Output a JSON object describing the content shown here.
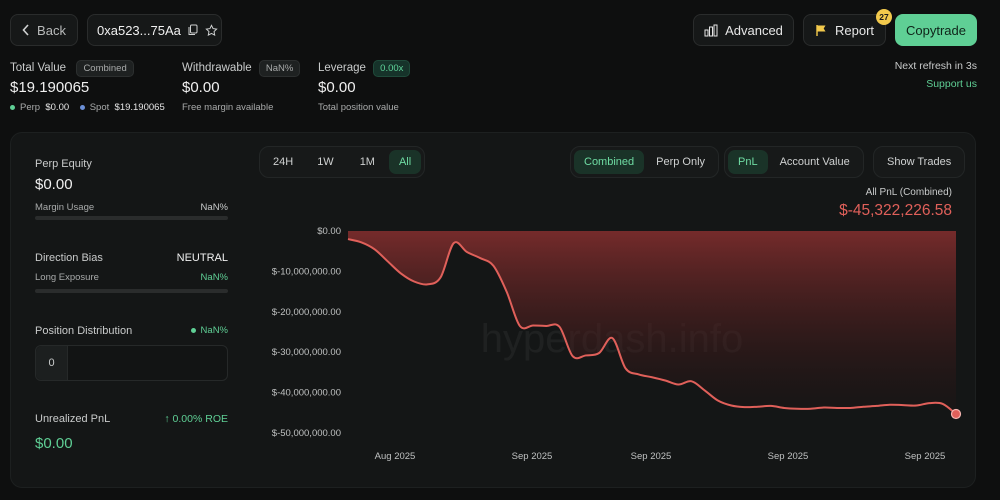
{
  "header": {
    "back_label": "Back",
    "address": "0xa523...75Aa",
    "advanced_label": "Advanced",
    "report_label": "Report",
    "report_badge": "27",
    "copytrade_label": "Copytrade"
  },
  "summary": {
    "total_value_label": "Total Value",
    "total_value_tag": "Combined",
    "total_value": "$19.190065",
    "perp_label": "Perp",
    "perp_value": "$0.00",
    "spot_label": "Spot",
    "spot_value": "$19.190065",
    "withdrawable_label": "Withdrawable",
    "withdrawable_tag": "NaN%",
    "withdrawable_value": "$0.00",
    "withdrawable_sub": "Free margin available",
    "leverage_label": "Leverage",
    "leverage_tag": "0.00x",
    "leverage_value": "$0.00",
    "leverage_sub": "Total position value",
    "refresh_text": "Next refresh in 3s",
    "support_label": "Support us"
  },
  "sidebar": {
    "perp_equity_label": "Perp Equity",
    "perp_equity_value": "$0.00",
    "margin_usage_label": "Margin Usage",
    "margin_usage_value": "NaN%",
    "direction_bias_label": "Direction Bias",
    "direction_bias_value": "NEUTRAL",
    "long_exposure_label": "Long Exposure",
    "long_exposure_value": "NaN%",
    "position_dist_label": "Position Distribution",
    "position_dist_value": "NaN%",
    "position_count": "0",
    "unrealized_label": "Unrealized PnL",
    "roe_value": "↑ 0.00% ROE",
    "unrealized_value": "$0.00"
  },
  "controls": {
    "ranges": [
      "24H",
      "1W",
      "1M",
      "All"
    ],
    "active_range": "All",
    "modes": [
      "Combined",
      "Perp Only"
    ],
    "active_mode": "Combined",
    "metrics": [
      "PnL",
      "Account Value"
    ],
    "active_metric": "PnL",
    "show_trades_label": "Show Trades"
  },
  "chart_data": {
    "type": "area",
    "title": "All PnL (Combined)",
    "headline_value": "$-45,322,226.58",
    "watermark": "hyperdash.info",
    "yticks": [
      "$0.00",
      "$-10,000,000.00",
      "$-20,000,000.00",
      "$-30,000,000.00",
      "$-40,000,000.00",
      "$-50,000,000.00"
    ],
    "xticks": [
      "Aug 2025",
      "Sep 2025",
      "Sep 2025",
      "Sep 2025",
      "Sep 2025"
    ],
    "ylim": [
      -50000000,
      0
    ],
    "grid": false,
    "values": [
      -2000000,
      -2800000,
      -4500000,
      -7500000,
      -10500000,
      -12500000,
      -13200000,
      -11500000,
      -3000000,
      -5200000,
      -6700000,
      -8600000,
      -15000000,
      -23500000,
      -23400000,
      -23500000,
      -23700000,
      -31000000,
      -30800000,
      -30200000,
      -26500000,
      -34000000,
      -35500000,
      -36200000,
      -37000000,
      -38000000,
      -37200000,
      -39500000,
      -42000000,
      -43200000,
      -43600000,
      -43500000,
      -43300000,
      -43800000,
      -44000000,
      -44000000,
      -43700000,
      -43800000,
      -43800000,
      -43500000,
      -43300000,
      -43000000,
      -43100000,
      -43200000,
      -42600000,
      -42800000,
      -45300000
    ],
    "line_color": "#e0605a",
    "fill_color": "#7a2c2c"
  }
}
